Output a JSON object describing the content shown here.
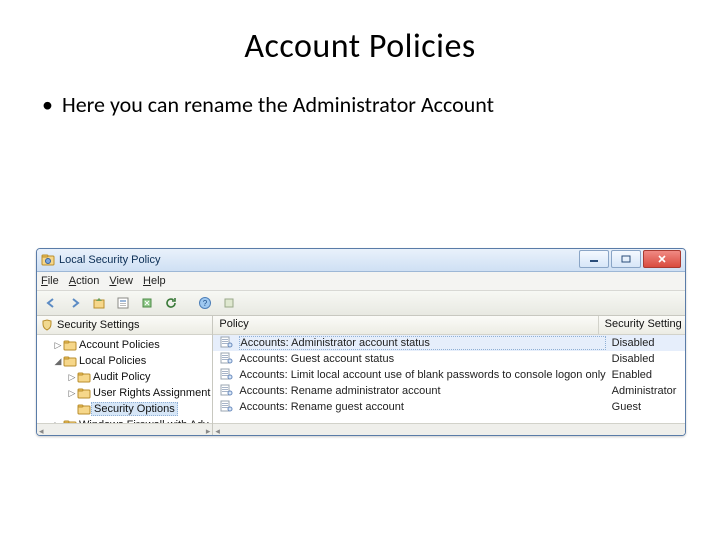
{
  "slide": {
    "title": "Account Policies",
    "bullet": "Here you can rename the Administrator Account"
  },
  "window": {
    "title": "Local Security Policy",
    "menus": {
      "file": "File",
      "action": "Action",
      "view": "View",
      "help": "Help"
    },
    "tree": {
      "header": "Security Settings",
      "items": [
        {
          "indent": 1,
          "expander": "▷",
          "icon": "folder",
          "label": "Account Policies"
        },
        {
          "indent": 1,
          "expander": "◢",
          "icon": "folder",
          "label": "Local Policies"
        },
        {
          "indent": 2,
          "expander": "▷",
          "icon": "folder",
          "label": "Audit Policy"
        },
        {
          "indent": 2,
          "expander": "▷",
          "icon": "folder",
          "label": "User Rights Assignment"
        },
        {
          "indent": 2,
          "expander": "",
          "icon": "folder",
          "label": "Security Options",
          "selected": true
        },
        {
          "indent": 1,
          "expander": "▷",
          "icon": "folder",
          "label": "Windows Firewall with Adv"
        }
      ]
    },
    "list": {
      "headers": {
        "policy": "Policy",
        "setting": "Security Setting"
      },
      "rows": [
        {
          "name": "Accounts: Administrator account status",
          "setting": "Disabled",
          "selected": true
        },
        {
          "name": "Accounts: Guest account status",
          "setting": "Disabled"
        },
        {
          "name": "Accounts: Limit local account use of blank passwords to console logon only",
          "setting": "Enabled"
        },
        {
          "name": "Accounts: Rename administrator account",
          "setting": "Administrator"
        },
        {
          "name": "Accounts: Rename guest account",
          "setting": "Guest"
        }
      ]
    }
  }
}
